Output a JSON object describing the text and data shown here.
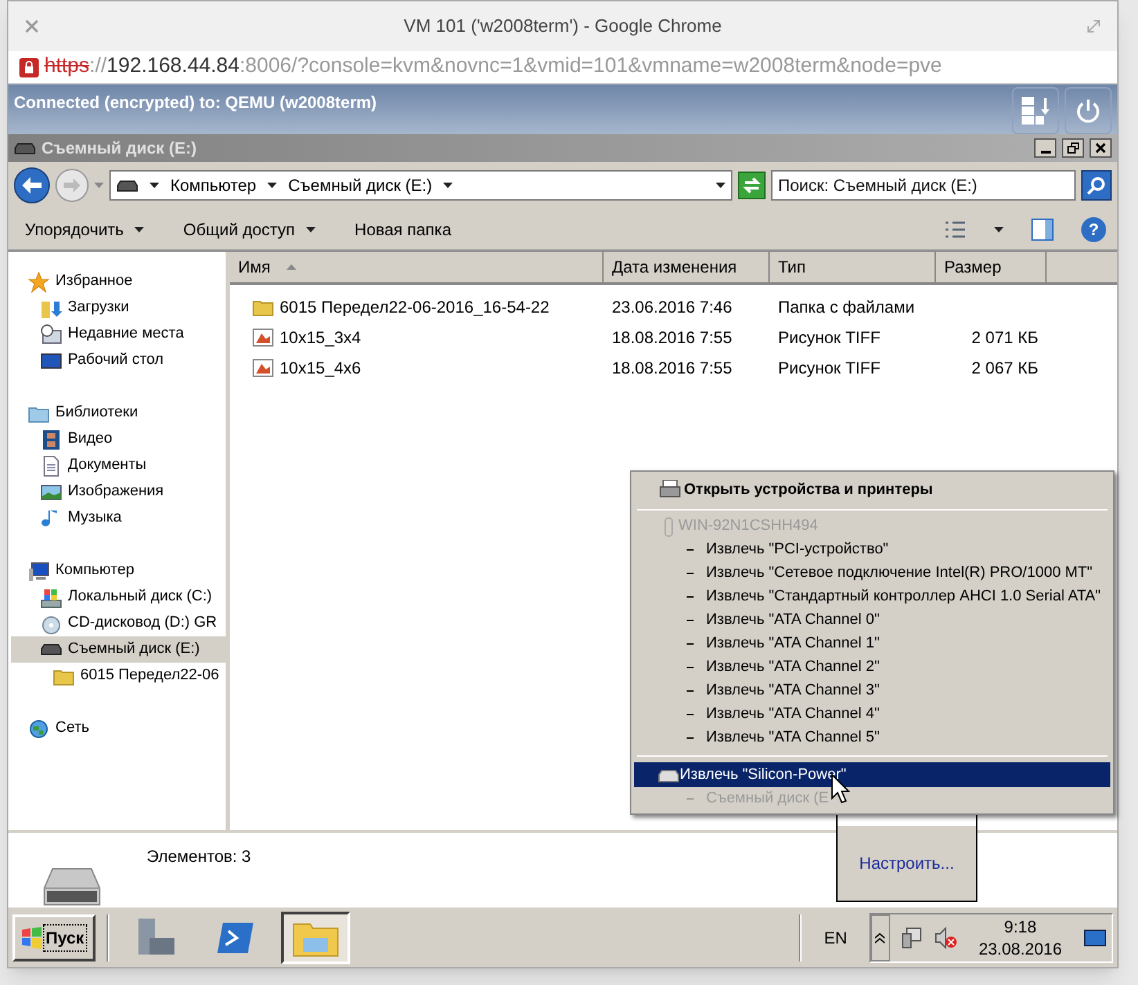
{
  "browser": {
    "title": "VM 101 ('w2008term') - Google Chrome",
    "url": {
      "scheme": "https",
      "separator": "://",
      "host": "192.168.44.84",
      "rest": ":8006/?console=kvm&novnc=1&vmid=101&vmname=w2008term&node=pve"
    }
  },
  "vnc_bar": {
    "status": "Connected (encrypted) to: QEMU (w2008term)"
  },
  "explorer": {
    "title": "Съемный диск (E:)",
    "breadcrumbs": [
      "Компьютер",
      "Съемный диск (E:)"
    ],
    "search": {
      "placeholder": "Поиск: Съемный диск (E:)"
    },
    "toolbar": [
      {
        "label": "Упорядочить",
        "dropdown": true
      },
      {
        "label": "Общий доступ",
        "dropdown": true
      },
      {
        "label": "Новая папка",
        "dropdown": false
      }
    ],
    "nav": [
      {
        "label": "Избранное",
        "kind": "star",
        "selected": false,
        "children": [
          {
            "label": "Загрузки",
            "kind": "downloads",
            "selected": false
          },
          {
            "label": "Недавние места",
            "kind": "recent",
            "selected": false
          },
          {
            "label": "Рабочий стол",
            "kind": "desktop",
            "selected": false
          }
        ]
      },
      {
        "label": "Библиотеки",
        "kind": "library",
        "selected": false,
        "children": [
          {
            "label": "Видео",
            "kind": "video",
            "selected": false
          },
          {
            "label": "Документы",
            "kind": "docs",
            "selected": false
          },
          {
            "label": "Изображения",
            "kind": "pictures",
            "selected": false
          },
          {
            "label": "Музыка",
            "kind": "music",
            "selected": false
          }
        ]
      },
      {
        "label": "Компьютер",
        "kind": "computer",
        "selected": false,
        "children": [
          {
            "label": "Локальный диск (C:)",
            "kind": "hdd",
            "selected": false
          },
          {
            "label": "CD-дисковод (D:) GR",
            "kind": "cd",
            "selected": false
          },
          {
            "label": "Съемный диск (E:)",
            "kind": "removable",
            "selected": true,
            "children": [
              {
                "label": "6015 Передел22-06",
                "kind": "folder",
                "selected": false
              }
            ]
          }
        ]
      },
      {
        "label": "Сеть",
        "kind": "network",
        "selected": false
      }
    ],
    "columns": [
      "Имя",
      "Дата изменения",
      "Тип",
      "Размер"
    ],
    "rows": [
      {
        "kind": "folder",
        "name": "6015 Передел22-06-2016_16-54-22",
        "date": "23.06.2016 7:46",
        "type": "Папка с файлами",
        "size": ""
      },
      {
        "kind": "image",
        "name": "10x15_3x4",
        "date": "18.08.2016 7:55",
        "type": "Рисунок TIFF",
        "size": "2 071 КБ"
      },
      {
        "kind": "image",
        "name": "10x15_4x6",
        "date": "18.08.2016 7:55",
        "type": "Рисунок TIFF",
        "size": "2 067 КБ"
      }
    ],
    "details": "Элементов: 3",
    "help_glyph": "?"
  },
  "eject_menu": {
    "header": "Открыть устройства и принтеры",
    "computer": {
      "label": "WIN-92N1CSHH494",
      "disabled": true
    },
    "items": [
      {
        "label": "Извлечь \"PCI-устройство\""
      },
      {
        "label": "Извлечь \"Сетевое подключение Intel(R) PRO/1000 MT\""
      },
      {
        "label": "Извлечь \"Стандартный контроллер AHCI 1.0 Serial ATA\""
      },
      {
        "label": "Извлечь \"ATA Channel 0\""
      },
      {
        "label": "Извлечь \"ATA Channel 1\""
      },
      {
        "label": "Извлечь \"ATA Channel 2\""
      },
      {
        "label": "Извлечь \"ATA Channel 3\""
      },
      {
        "label": "Извлечь \"ATA Channel 4\""
      },
      {
        "label": "Извлечь \"ATA Channel 5\""
      }
    ],
    "device": {
      "label": "Извлечь \"Silicon-Power\"",
      "selected": true,
      "sub": {
        "label": "Съемный диск (E",
        "disabled": true
      }
    }
  },
  "tray_popup": {
    "link": "Настроить..."
  },
  "taskbar": {
    "start": "Пуск",
    "language": "EN",
    "time": "9:18",
    "date": "23.08.2016"
  }
}
